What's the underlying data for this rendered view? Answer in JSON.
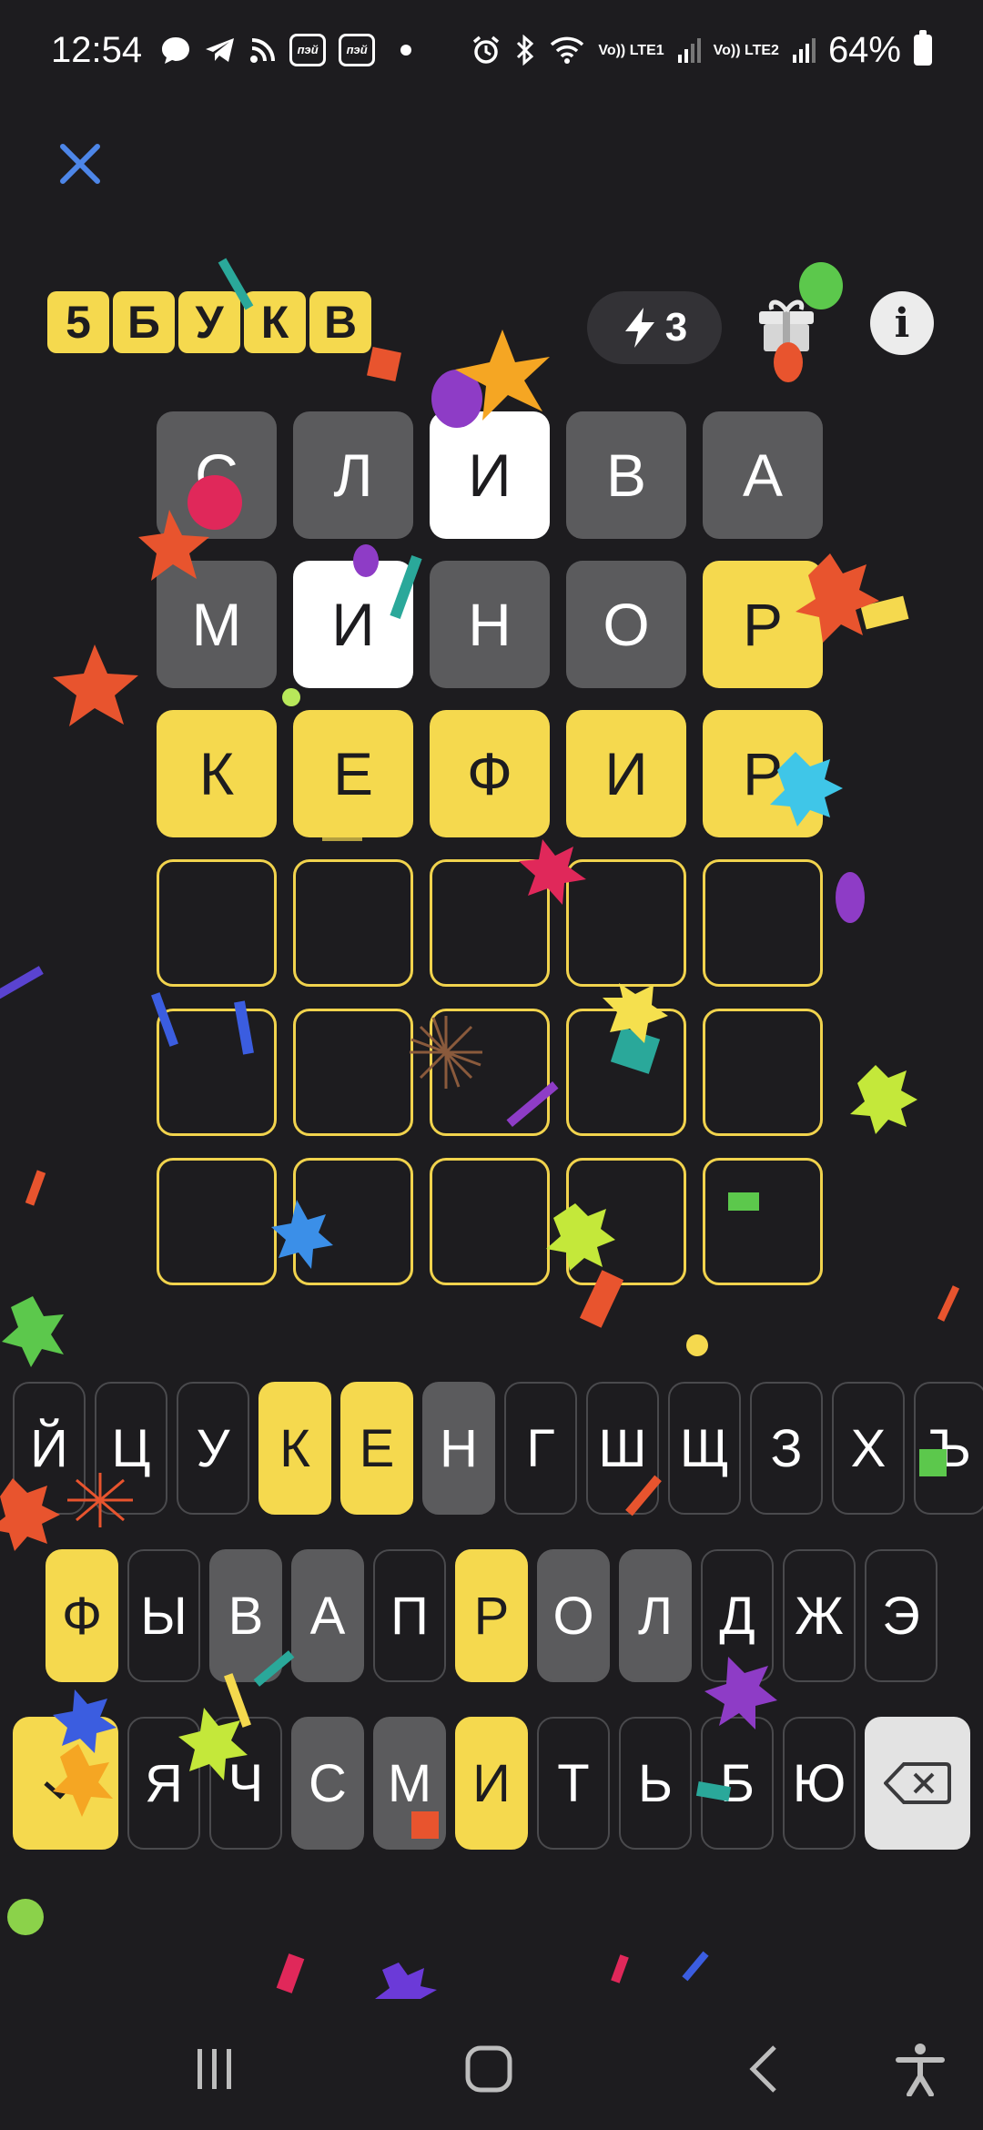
{
  "status_bar": {
    "time": "12:54",
    "app_badge_1": "пэй",
    "app_badge_2": "пэй",
    "sim1": "Vo)) LTE1",
    "sim2": "Vo)) LTE2",
    "battery": "64%"
  },
  "header": {
    "logo_letters": [
      "5",
      "Б",
      "У",
      "К",
      "В"
    ],
    "hints_count": "3"
  },
  "board": {
    "rows": [
      [
        {
          "l": "С",
          "s": "gray"
        },
        {
          "l": "Л",
          "s": "gray"
        },
        {
          "l": "И",
          "s": "white"
        },
        {
          "l": "В",
          "s": "gray"
        },
        {
          "l": "А",
          "s": "gray"
        }
      ],
      [
        {
          "l": "М",
          "s": "gray"
        },
        {
          "l": "И",
          "s": "white"
        },
        {
          "l": "Н",
          "s": "gray"
        },
        {
          "l": "О",
          "s": "gray"
        },
        {
          "l": "Р",
          "s": "yellow"
        }
      ],
      [
        {
          "l": "К",
          "s": "yellow"
        },
        {
          "l": "Е",
          "s": "yellow"
        },
        {
          "l": "Ф",
          "s": "yellow"
        },
        {
          "l": "И",
          "s": "yellow"
        },
        {
          "l": "Р",
          "s": "yellow"
        }
      ],
      [
        {
          "l": "",
          "s": "empty"
        },
        {
          "l": "",
          "s": "empty"
        },
        {
          "l": "",
          "s": "empty"
        },
        {
          "l": "",
          "s": "empty"
        },
        {
          "l": "",
          "s": "empty"
        }
      ],
      [
        {
          "l": "",
          "s": "empty"
        },
        {
          "l": "",
          "s": "empty"
        },
        {
          "l": "",
          "s": "empty"
        },
        {
          "l": "",
          "s": "empty"
        },
        {
          "l": "",
          "s": "empty"
        }
      ],
      [
        {
          "l": "",
          "s": "empty"
        },
        {
          "l": "",
          "s": "empty"
        },
        {
          "l": "",
          "s": "empty"
        },
        {
          "l": "",
          "s": "empty"
        },
        {
          "l": "",
          "s": "empty"
        }
      ]
    ]
  },
  "keyboard": {
    "row1": [
      {
        "l": "Й",
        "s": "none"
      },
      {
        "l": "Ц",
        "s": "none"
      },
      {
        "l": "У",
        "s": "none"
      },
      {
        "l": "К",
        "s": "yellow"
      },
      {
        "l": "Е",
        "s": "yellow"
      },
      {
        "l": "Н",
        "s": "gray"
      },
      {
        "l": "Г",
        "s": "none"
      },
      {
        "l": "Ш",
        "s": "none"
      },
      {
        "l": "Щ",
        "s": "none"
      },
      {
        "l": "З",
        "s": "none"
      },
      {
        "l": "Х",
        "s": "none"
      },
      {
        "l": "Ъ",
        "s": "none"
      }
    ],
    "row2": [
      {
        "l": "Ф",
        "s": "yellow"
      },
      {
        "l": "Ы",
        "s": "none"
      },
      {
        "l": "В",
        "s": "gray"
      },
      {
        "l": "А",
        "s": "gray"
      },
      {
        "l": "П",
        "s": "none"
      },
      {
        "l": "Р",
        "s": "yellow"
      },
      {
        "l": "О",
        "s": "gray"
      },
      {
        "l": "Л",
        "s": "gray"
      },
      {
        "l": "Д",
        "s": "none"
      },
      {
        "l": "Ж",
        "s": "none"
      },
      {
        "l": "Э",
        "s": "none"
      }
    ],
    "row3": [
      {
        "l": "Я",
        "s": "none"
      },
      {
        "l": "Ч",
        "s": "none"
      },
      {
        "l": "С",
        "s": "gray"
      },
      {
        "l": "М",
        "s": "gray"
      },
      {
        "l": "И",
        "s": "yellow"
      },
      {
        "l": "Т",
        "s": "none"
      },
      {
        "l": "Ь",
        "s": "none"
      },
      {
        "l": "Б",
        "s": "none"
      },
      {
        "l": "Ю",
        "s": "none"
      }
    ],
    "enter_icon": "check-icon",
    "backspace_icon": "backspace-icon"
  },
  "colors": {
    "background": "#1d1c1f",
    "correct": "#f5d94e",
    "absent": "#5b5b5d",
    "present": "#ffffff",
    "accent_close": "#4d86e8"
  }
}
